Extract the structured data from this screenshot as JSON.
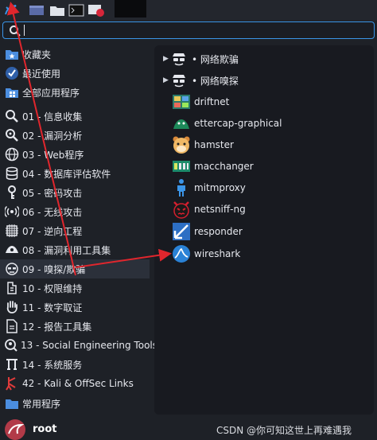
{
  "taskbar": {
    "items": [
      {
        "name": "kali-menu-icon"
      },
      {
        "name": "workspace-icon"
      },
      {
        "name": "files-icon"
      },
      {
        "name": "terminal-icon"
      },
      {
        "name": "recorder-icon"
      }
    ]
  },
  "search": {
    "value": ""
  },
  "left_menu": {
    "items": [
      {
        "label": "收藏夹",
        "icon": "star-folder-icon"
      },
      {
        "label": "最近使用",
        "icon": "recent-icon"
      },
      {
        "label": "全部应用程序",
        "icon": "apps-icon"
      },
      {
        "label": "01 - 信息收集",
        "icon": "magnifier-icon"
      },
      {
        "label": "02 - 漏洞分析",
        "icon": "vuln-icon"
      },
      {
        "label": "03 - Web程序",
        "icon": "globe-icon"
      },
      {
        "label": "04 - 数据库评估软件",
        "icon": "database-icon"
      },
      {
        "label": "05 - 密码攻击",
        "icon": "key-icon"
      },
      {
        "label": "06 - 无线攻击",
        "icon": "wireless-icon"
      },
      {
        "label": "07 - 逆向工程",
        "icon": "chip-icon"
      },
      {
        "label": "08 - 漏洞利用工具集",
        "icon": "exploit-icon"
      },
      {
        "label": "09 - 嗅探/欺骗",
        "icon": "sniff-icon",
        "selected": true
      },
      {
        "label": "10 - 权限维持",
        "icon": "tool-icon"
      },
      {
        "label": "11 - 数字取证",
        "icon": "hand-icon"
      },
      {
        "label": "12 - 报告工具集",
        "icon": "report-icon"
      },
      {
        "label": "13 - Social Engineering Tools",
        "icon": "social-icon"
      },
      {
        "label": "14 - 系统服务",
        "icon": "service-icon"
      },
      {
        "label": "42 - Kali & OffSec Links",
        "icon": "kali-links-icon"
      },
      {
        "label": "常用程序",
        "icon": "folder-icon"
      }
    ]
  },
  "right_panel": {
    "items": [
      {
        "label": "• 网络欺骗",
        "icon": "spy-icon",
        "has_arrow": true
      },
      {
        "label": "• 网络嗅探",
        "icon": "spy-icon",
        "has_arrow": true
      },
      {
        "label": "driftnet",
        "icon": "driftnet-icon"
      },
      {
        "label": "ettercap-graphical",
        "icon": "ettercap-icon"
      },
      {
        "label": "hamster",
        "icon": "hamster-icon"
      },
      {
        "label": "macchanger",
        "icon": "macchanger-icon"
      },
      {
        "label": "mitmproxy",
        "icon": "mitmproxy-icon"
      },
      {
        "label": "netsniff-ng",
        "icon": "netsniff-icon"
      },
      {
        "label": "responder",
        "icon": "responder-icon"
      },
      {
        "label": "wireshark",
        "icon": "wireshark-icon"
      }
    ]
  },
  "user": {
    "name": "root"
  },
  "watermark": "CSDN @你可知这世上再难遇我",
  "colors": {
    "accent": "#3b95e8",
    "arrow_red": "#e0262d",
    "background": "#1e2127",
    "panel": "#181a20"
  }
}
